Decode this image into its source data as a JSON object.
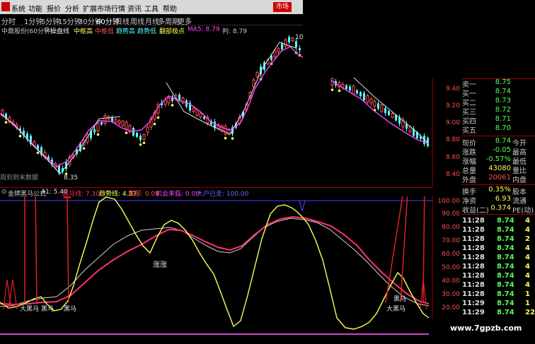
{
  "menu": {
    "items": [
      "系统",
      "功能",
      "报价",
      "分析",
      "扩展市场行情",
      "资讯",
      "工具",
      "帮助"
    ],
    "active_tab": "市场"
  },
  "periods": [
    "分时",
    "1分钟",
    "5分钟",
    "15分钟",
    "30分钟",
    "60分钟",
    "日线",
    "周线",
    "月线",
    "多周期",
    "更多"
  ],
  "main_header": {
    "title": "中鼎股份(60分钟)",
    "switch_label": "操盘线",
    "items": [
      "中枢高",
      "中枢低",
      "趋势高",
      "趋势低",
      "翻部极点"
    ],
    "ma_label": "MA5: 8.79",
    "extra_label": "判: 8.79"
  },
  "main_annotations": {
    "low_marker": "8.35",
    "high_marker": "10",
    "no_data_text": "周到到末数据"
  },
  "indicator_header": {
    "title": "金牌黑马公式",
    "a1": "A1: 5.40",
    "black_horse": "黑马线: 7.30",
    "trend": "趋势线: 4.37",
    "bottom": "底部: 0.00",
    "opportunity": "机会来临: 0.00",
    "main_in": "大户已走: 100.00"
  },
  "indicator_annotations": {
    "mid_label": "涨涨",
    "black_horse_labels": [
      "大黑马",
      "黑马",
      "黑马",
      "大黑马",
      "黑马"
    ]
  },
  "price_ticks": [
    "9.40",
    "9.20",
    "9.00",
    "8.80",
    "8.60",
    "8.40"
  ],
  "indicator_ticks": [
    "100.00",
    "90.00",
    "80.00",
    "70.00",
    "60.00",
    "50.00",
    "40.00",
    "30.00",
    "20.00"
  ],
  "order_book": [
    {
      "label": "卖一",
      "value": "8.75"
    },
    {
      "label": "买一",
      "value": "8.74"
    },
    {
      "label": "买二",
      "value": "8.73"
    },
    {
      "label": "买三",
      "value": "8.72"
    },
    {
      "label": "买四",
      "value": "8.71"
    },
    {
      "label": "买五",
      "value": "8.70"
    }
  ],
  "quote": [
    {
      "label": "现价",
      "value": "8.74",
      "label2": "今开"
    },
    {
      "label": "涨跌",
      "value": "-0.05",
      "label2": "最高"
    },
    {
      "label": "涨幅",
      "value": "-0.57%",
      "label2": "最低"
    },
    {
      "label": "总量",
      "value": "43080",
      "label2": "量比"
    },
    {
      "label": "外盘",
      "value": "20061",
      "label2": "内盘"
    }
  ],
  "stats": [
    {
      "label": "换手",
      "value": "0.35%",
      "label2": "股本"
    },
    {
      "label": "净资",
      "value": "6.93",
      "label2": "流通"
    },
    {
      "label": "收益(二)",
      "value": "0.374",
      "label2": "PE(动)"
    }
  ],
  "trades": [
    {
      "time": "11:28",
      "price": "8.74",
      "vol": "4"
    },
    {
      "time": "11:28",
      "price": "8.74",
      "vol": "4"
    },
    {
      "time": "11:28",
      "price": "8.74",
      "vol": "2"
    },
    {
      "time": "11:28",
      "price": "8.74",
      "vol": "4"
    },
    {
      "time": "11:28",
      "price": "8.74",
      "vol": "4"
    },
    {
      "time": "11:28",
      "price": "8.74",
      "vol": "4"
    },
    {
      "time": "11:28",
      "price": "8.74",
      "vol": "4"
    },
    {
      "time": "11:28",
      "price": "8.74",
      "vol": "4"
    },
    {
      "time": "11:28",
      "price": "8.74",
      "vol": "1"
    },
    {
      "time": "11:29",
      "price": "8.74",
      "vol": "1"
    },
    {
      "time": "11:29",
      "price": "8.74",
      "vol": "22"
    }
  ],
  "watermark": "www.7gpzb.com",
  "colors": {
    "up": "#ff5050",
    "down": "#54fcfc",
    "yellow": "#ffff55",
    "magenta": "#ff44ff",
    "pink": "#ff3070",
    "arrow": "#e02020",
    "blue_label": "#6a6aff",
    "green_label": "#55ff55"
  }
}
